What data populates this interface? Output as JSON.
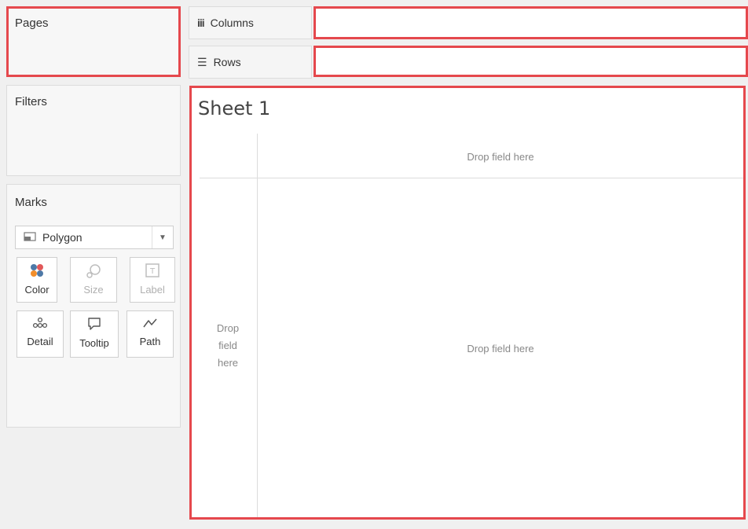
{
  "left": {
    "pages_title": "Pages",
    "filters_title": "Filters",
    "marks_title": "Marks"
  },
  "marks": {
    "type_selected": "Polygon",
    "type_icon": "polygon-mark-icon",
    "buttons": {
      "color": "Color",
      "size": "Size",
      "label": "Label",
      "detail": "Detail",
      "tooltip": "Tooltip",
      "path": "Path"
    }
  },
  "shelves": {
    "columns_label": "Columns",
    "rows_label": "Rows"
  },
  "view": {
    "sheet_title": "Sheet 1",
    "drop_hint_top": "Drop field here",
    "drop_hint_left": "Drop field here",
    "drop_hint_main": "Drop field here"
  },
  "colors": {
    "highlight": "#e5484d",
    "color_dots": [
      "#4e79a7",
      "#e15759",
      "#f28e2b",
      "#4e79a7"
    ]
  }
}
